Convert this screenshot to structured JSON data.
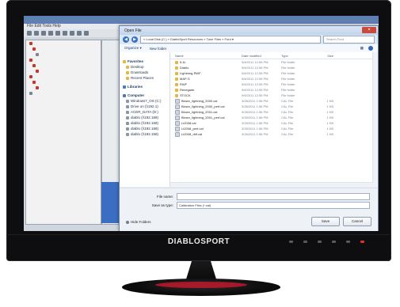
{
  "brand": "DIABLOSPORT",
  "background_app": {
    "menu": "File Edit Tools Help",
    "tree_rows": [
      {
        "icon": "red"
      },
      {
        "icon": "red"
      },
      {
        "icon": "blue"
      },
      {
        "icon": "red"
      },
      {
        "icon": "red"
      },
      {
        "icon": "red"
      },
      {
        "icon": "red"
      },
      {
        "icon": "red"
      },
      {
        "icon": "red"
      },
      {
        "icon": "blue"
      }
    ]
  },
  "dialog": {
    "title": "Open File",
    "close": "×",
    "address": "« Local Disk (C:) » DiabloSport Resources » Tune Files » Ford ▾",
    "search_placeholder": "Search Ford",
    "commands": {
      "organize": "Organize ▾",
      "new_folder": "New folder"
    },
    "nav": [
      {
        "label": "Favorites",
        "icon": "star",
        "header": true
      },
      {
        "label": "Desktop",
        "icon": "folder"
      },
      {
        "label": "Downloads",
        "icon": "folder"
      },
      {
        "label": "Recent Places",
        "icon": "folder"
      },
      {
        "label": "Libraries",
        "icon": "library",
        "header": true
      },
      {
        "label": "Computer",
        "icon": "computer",
        "header": true
      },
      {
        "label": "Windows7_OS (C:)",
        "icon": "drive"
      },
      {
        "label": "Drive on (\\\\192.1)",
        "icon": "drive"
      },
      {
        "label": "ACER_DATA (D:)",
        "icon": "drive"
      },
      {
        "label": "diablo (\\\\192.168)",
        "icon": "drive"
      },
      {
        "label": "diablo (\\\\192.168)",
        "icon": "drive"
      },
      {
        "label": "diablo (\\\\192.168)",
        "icon": "drive"
      },
      {
        "label": "diablo (\\\\192.168)",
        "icon": "drive"
      }
    ],
    "columns": {
      "name": "Name",
      "date": "Date modified",
      "type": "Type",
      "size": "Size"
    },
    "files": [
      {
        "name": "5.4L",
        "date": "9/6/2011 12:55 PM",
        "type": "File folder",
        "size": "",
        "kind": "folder"
      },
      {
        "name": "Diablo",
        "date": "9/6/2011 12:55 PM",
        "type": "File folder",
        "size": "",
        "kind": "folder"
      },
      {
        "name": "Lightning-RWF",
        "date": "9/6/2011 12:55 PM",
        "type": "File folder",
        "size": "",
        "kind": "folder"
      },
      {
        "name": "MAP-S",
        "date": "9/6/2011 12:55 PM",
        "type": "File folder",
        "size": "",
        "kind": "folder"
      },
      {
        "name": "RWF",
        "date": "9/6/2011 12:55 PM",
        "type": "File folder",
        "size": "",
        "kind": "folder"
      },
      {
        "name": "Renegade",
        "date": "9/6/2011 12:55 PM",
        "type": "File folder",
        "size": "",
        "kind": "folder"
      },
      {
        "name": "STOCK",
        "date": "9/6/2011 12:55 PM",
        "type": "File folder",
        "size": "",
        "kind": "folder"
      },
      {
        "name": "Blown_lightning_2000.cal",
        "date": "3/28/2011 1:56 PM",
        "type": "CAL File",
        "size": "1 KB",
        "kind": "doc"
      },
      {
        "name": "Blown_lightning_2000_perf.cal",
        "date": "3/28/2011 1:56 PM",
        "type": "CAL File",
        "size": "1 KB",
        "kind": "doc"
      },
      {
        "name": "Blown_lightning_2001.cal",
        "date": "3/28/2011 1:56 PM",
        "type": "CAL File",
        "size": "1 KB",
        "kind": "doc"
      },
      {
        "name": "Blown_lightning_2001_perf.cal",
        "date": "3/28/2011 1:56 PM",
        "type": "CAL File",
        "size": "1 KB",
        "kind": "doc"
      },
      {
        "name": "Lt2008.cal",
        "date": "3/28/2011 1:56 PM",
        "type": "CAL File",
        "size": "1 KB",
        "kind": "doc"
      },
      {
        "name": "Lt2008_perf.cal",
        "date": "3/28/2011 1:56 PM",
        "type": "CAL File",
        "size": "1 KB",
        "kind": "doc"
      },
      {
        "name": "Lt2008_rbfl.cal",
        "date": "3/28/2011 1:56 PM",
        "type": "CAL File",
        "size": "1 KB",
        "kind": "doc"
      }
    ],
    "footer": {
      "file_name_label": "File name:",
      "file_name_value": "",
      "save_type_label": "Save as type:",
      "save_type_value": "Calibration Files (*.cal)",
      "hide_folders": "Hide Folders",
      "save_label": "Save",
      "cancel_label": "Cancel"
    }
  }
}
